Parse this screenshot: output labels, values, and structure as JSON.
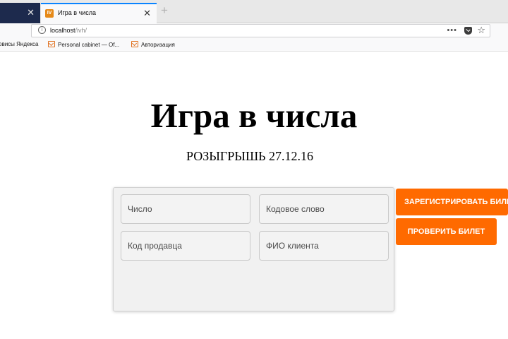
{
  "browser": {
    "active_tab_title": "Игра в числа",
    "url_host": "localhost",
    "url_path": "/ivh/",
    "menu_dots": "•••",
    "bookmarks": [
      {
        "label": "рвисы Яндекса",
        "icon": "none"
      },
      {
        "label": "Personal cabinet — Of...",
        "icon": "mail-icon"
      },
      {
        "label": "Авторизация",
        "icon": "mail-icon"
      }
    ]
  },
  "page": {
    "title": "Игра в числа",
    "subtitle": "РОЗЫГРЫШЬ 27.12.16"
  },
  "form": {
    "number_placeholder": "Число",
    "code_word_placeholder": "Кодовое слово",
    "seller_code_placeholder": "Код продавца",
    "client_name_placeholder": "ФИО клиента"
  },
  "buttons": {
    "register_label": "ЗАРЕГИСТРИРОВАТЬ БИЛЕТ",
    "check_label": "ПРОВЕРИТЬ БИЛЕТ"
  },
  "colors": {
    "accent": "#ff6a00",
    "tab_highlight": "#0a84ff",
    "prev_tab": "#1d2a4d"
  }
}
